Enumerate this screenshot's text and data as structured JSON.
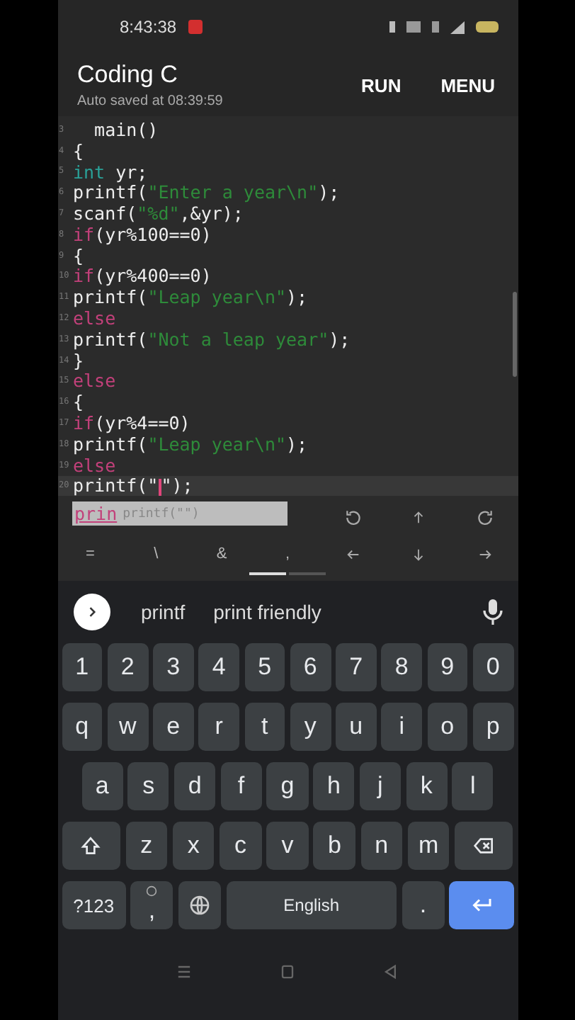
{
  "status_bar": {
    "time": "8:43:38"
  },
  "app_bar": {
    "title": "Coding C",
    "subtitle": "Auto saved at 08:39:59",
    "actions": [
      "RUN",
      "MENU"
    ]
  },
  "editor": {
    "lines": [
      {
        "number": "3",
        "current": false,
        "segments": [
          {
            "text": "  main()",
            "kind": "plain"
          }
        ]
      },
      {
        "number": "4",
        "current": false,
        "segments": [
          {
            "text": "{",
            "kind": "plain"
          }
        ]
      },
      {
        "number": "5",
        "current": false,
        "segments": [
          {
            "text": "int",
            "kind": "type"
          },
          {
            "text": " yr;",
            "kind": "plain"
          }
        ]
      },
      {
        "number": "6",
        "current": false,
        "segments": [
          {
            "text": "printf(",
            "kind": "plain"
          },
          {
            "text": "\"Enter a year\\n\"",
            "kind": "string"
          },
          {
            "text": ");",
            "kind": "plain"
          }
        ]
      },
      {
        "number": "7",
        "current": false,
        "segments": [
          {
            "text": "scanf(",
            "kind": "plain"
          },
          {
            "text": "\"%d\"",
            "kind": "string"
          },
          {
            "text": ",&yr);",
            "kind": "plain"
          }
        ]
      },
      {
        "number": "8",
        "current": false,
        "segments": [
          {
            "text": "if",
            "kind": "keyword"
          },
          {
            "text": "(yr%100==0)",
            "kind": "plain"
          }
        ]
      },
      {
        "number": "9",
        "current": false,
        "segments": [
          {
            "text": "{",
            "kind": "plain"
          }
        ]
      },
      {
        "number": "10",
        "current": false,
        "segments": [
          {
            "text": "if",
            "kind": "keyword"
          },
          {
            "text": "(yr%400==0)",
            "kind": "plain"
          }
        ]
      },
      {
        "number": "11",
        "current": false,
        "segments": [
          {
            "text": "printf(",
            "kind": "plain"
          },
          {
            "text": "\"Leap year\\n\"",
            "kind": "string"
          },
          {
            "text": ");",
            "kind": "plain"
          }
        ]
      },
      {
        "number": "12",
        "current": false,
        "segments": [
          {
            "text": "else",
            "kind": "keyword"
          }
        ]
      },
      {
        "number": "13",
        "current": false,
        "segments": [
          {
            "text": "printf(",
            "kind": "plain"
          },
          {
            "text": "\"Not a leap year\"",
            "kind": "string"
          },
          {
            "text": ");",
            "kind": "plain"
          }
        ]
      },
      {
        "number": "14",
        "current": false,
        "segments": [
          {
            "text": "}",
            "kind": "plain"
          }
        ]
      },
      {
        "number": "15",
        "current": false,
        "segments": [
          {
            "text": "else",
            "kind": "keyword"
          }
        ]
      },
      {
        "number": "16",
        "current": false,
        "segments": [
          {
            "text": "{",
            "kind": "plain"
          }
        ]
      },
      {
        "number": "17",
        "current": false,
        "segments": [
          {
            "text": "if",
            "kind": "keyword"
          },
          {
            "text": "(yr%4==0)",
            "kind": "plain"
          }
        ]
      },
      {
        "number": "18",
        "current": false,
        "segments": [
          {
            "text": "printf(",
            "kind": "plain"
          },
          {
            "text": "\"Leap year\\n\"",
            "kind": "string"
          },
          {
            "text": ");",
            "kind": "plain"
          }
        ]
      },
      {
        "number": "19",
        "current": false,
        "segments": [
          {
            "text": "else",
            "kind": "keyword"
          }
        ]
      },
      {
        "number": "20",
        "current": true,
        "segments": [
          {
            "text": "printf(\"",
            "kind": "plain"
          },
          {
            "text": "\");",
            "kind": "plain"
          }
        ]
      }
    ]
  },
  "autocomplete": {
    "typed": "prin",
    "suggestion": "printf(\"\")"
  },
  "symbol_keys": [
    "=",
    "\\",
    "&",
    ","
  ],
  "pages": [
    {
      "selected": true
    },
    {
      "selected": false
    }
  ],
  "keyboard": {
    "suggestions": [
      "printf",
      "print friendly"
    ],
    "rows": [
      [
        "1",
        "2",
        "3",
        "4",
        "5",
        "6",
        "7",
        "8",
        "9",
        "0"
      ],
      [
        "q",
        "w",
        "e",
        "r",
        "t",
        "y",
        "u",
        "i",
        "o",
        "p"
      ],
      [
        "a",
        "s",
        "d",
        "f",
        "g",
        "h",
        "j",
        "k",
        "l"
      ],
      [
        "z",
        "x",
        "c",
        "v",
        "b",
        "n",
        "m"
      ]
    ],
    "symbols": "?123",
    "comma": ",",
    "space": "English",
    "period": "."
  }
}
